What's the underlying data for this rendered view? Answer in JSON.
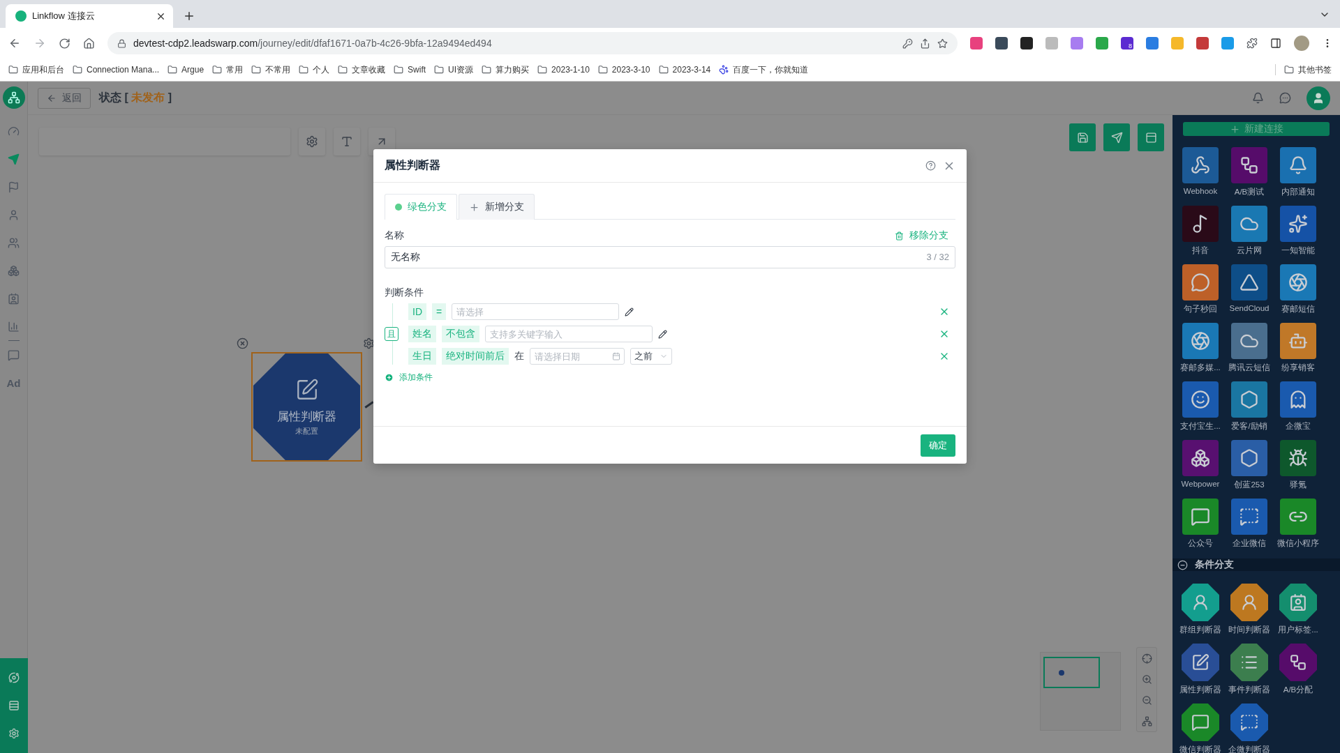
{
  "browser": {
    "tab_title": "Linkflow 连接云",
    "url_host": "devtest-cdp2.leadswarp.com",
    "url_path": "/journey/edit/dfaf1671-0a7b-4c26-9bfa-12a9494ed494",
    "extensions": [
      {
        "color": "#e8417e"
      },
      {
        "color": "#3a4a5a"
      },
      {
        "color": "#222222"
      },
      {
        "color": "#bbbbbb"
      },
      {
        "color": "#a77cf0"
      },
      {
        "color": "#2aa84a"
      },
      {
        "color": "#5b2bd1",
        "badge": "8"
      },
      {
        "color": "#2a7de1"
      },
      {
        "color": "#f5b82a"
      },
      {
        "color": "#c43a3a"
      },
      {
        "color": "#1a9be8"
      }
    ],
    "bookmarks": [
      {
        "kind": "folder",
        "label": "应用和后台"
      },
      {
        "kind": "folder",
        "label": "Connection Mana..."
      },
      {
        "kind": "folder",
        "label": "Argue"
      },
      {
        "kind": "folder",
        "label": "常用"
      },
      {
        "kind": "folder",
        "label": "不常用"
      },
      {
        "kind": "folder",
        "label": "个人"
      },
      {
        "kind": "folder",
        "label": "文章收藏"
      },
      {
        "kind": "folder",
        "label": "Swift"
      },
      {
        "kind": "folder",
        "label": "UI资源"
      },
      {
        "kind": "folder",
        "label": "算力购买"
      },
      {
        "kind": "folder",
        "label": "2023-1-10"
      },
      {
        "kind": "folder",
        "label": "2023-3-10"
      },
      {
        "kind": "folder",
        "label": "2023-3-14"
      },
      {
        "kind": "site",
        "label": "百度一下，你就知道"
      }
    ],
    "other_bookmarks": "其他书签"
  },
  "app": {
    "back_label": "返回",
    "status": {
      "prefix": "状态 [",
      "value": "未发布",
      "suffix": "]"
    },
    "sidebar": [
      {
        "selected": false
      },
      {
        "selected": true
      },
      {
        "selected": false
      },
      {
        "selected": false
      },
      {
        "selected": false
      },
      {
        "selected": false
      },
      {
        "selected": false
      },
      {
        "selected": false
      },
      {
        "selected": false
      }
    ],
    "ad_item": {
      "label": "Ad"
    },
    "canvas_node": {
      "title": "属性判断器",
      "subtitle": "未配置",
      "selected": true
    }
  },
  "dialog": {
    "title": "属性判断器",
    "tabs": [
      {
        "kind": "branch",
        "label": "绿色分支",
        "selected": true,
        "color": "#5bd08e"
      },
      {
        "kind": "add",
        "label": "新增分支",
        "selected": false
      }
    ],
    "name_label": "名称",
    "remove_label": "移除分支",
    "name_value": "无名称",
    "name_counter": "3 / 32",
    "conditions_label": "判断条件",
    "logic": "且",
    "conditions": [
      {
        "kind": "select",
        "field": "ID",
        "operator": "=",
        "placeholder": "请选择"
      },
      {
        "kind": "keywords",
        "field": "姓名",
        "operator": "不包含",
        "placeholder": "支持多关键字输入"
      },
      {
        "kind": "date",
        "field": "生日",
        "operator": "绝对时间前后",
        "connector": "在",
        "placeholder": "请选择日期",
        "direction": "之前"
      }
    ],
    "add_condition": "添加条件",
    "confirm": "确定"
  },
  "panel": {
    "new_connection": "新建连接",
    "connectors": [
      {
        "label": "Webhook",
        "color": "#1c5a96"
      },
      {
        "label": "A/B测试",
        "color": "#560c6a"
      },
      {
        "label": "内部通知",
        "color": "#1a70b0"
      },
      {
        "label": "抖音",
        "color": "#2a0a18"
      },
      {
        "label": "云片网",
        "color": "#1a78b2"
      },
      {
        "label": "一知智能",
        "color": "#1552a6"
      },
      {
        "label": "句子秒回",
        "color": "#bd6028"
      },
      {
        "label": "SendCloud",
        "color": "#0e4e88"
      },
      {
        "label": "赛邮短信",
        "color": "#1a78b5"
      },
      {
        "label": "赛邮多媒...",
        "color": "#1a78b5"
      },
      {
        "label": "腾讯云短信",
        "color": "#4a6e8e"
      },
      {
        "label": "纷享销客",
        "color": "#c07828"
      },
      {
        "label": "支付宝生...",
        "color": "#1a5aae"
      },
      {
        "label": "爱客/励销",
        "color": "#1a76a2"
      },
      {
        "label": "企微宝",
        "color": "#1a5aae"
      },
      {
        "label": "Webpower",
        "color": "#581070"
      },
      {
        "label": "创蓝253",
        "color": "#2a5ea6"
      },
      {
        "label": "驿氪",
        "color": "#0e582c"
      },
      {
        "label": "公众号",
        "color": "#1a8828"
      },
      {
        "label": "企业微信",
        "color": "#1a5aae"
      },
      {
        "label": "微信小程序",
        "color": "#1a8828"
      }
    ],
    "section": {
      "title": "条件分支",
      "expanded": true
    },
    "branch_nodes": [
      {
        "label": "群组判断器",
        "color": "#139e8e"
      },
      {
        "label": "时间判断器",
        "color": "#bd7820"
      },
      {
        "label": "用户标签...",
        "color": "#148e6e"
      },
      {
        "label": "属性判断器",
        "color": "#294e96"
      },
      {
        "label": "事件判断器",
        "color": "#3c7e4e"
      },
      {
        "label": "A/B分配",
        "color": "#560c6a"
      },
      {
        "label": "微信判断器",
        "color": "#1a8828"
      },
      {
        "label": "企微判断器",
        "color": "#1a5aae"
      }
    ]
  }
}
